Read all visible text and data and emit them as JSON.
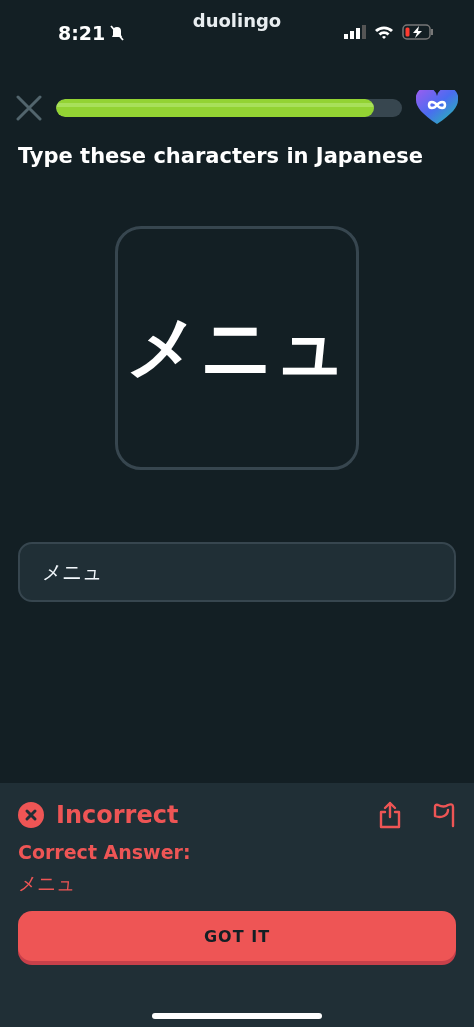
{
  "status_bar": {
    "time": "8:21",
    "app": "duolingo",
    "silenced": true,
    "charging": true
  },
  "progress": {
    "level": 0.92
  },
  "prompt": "Type these characters in Japanese",
  "character_card": "メニュ",
  "answer_field": {
    "value": "メニュ"
  },
  "feedback": {
    "result": "Incorrect",
    "label": "Correct Answer:",
    "answer": "メニュ",
    "button": "GOT IT"
  }
}
